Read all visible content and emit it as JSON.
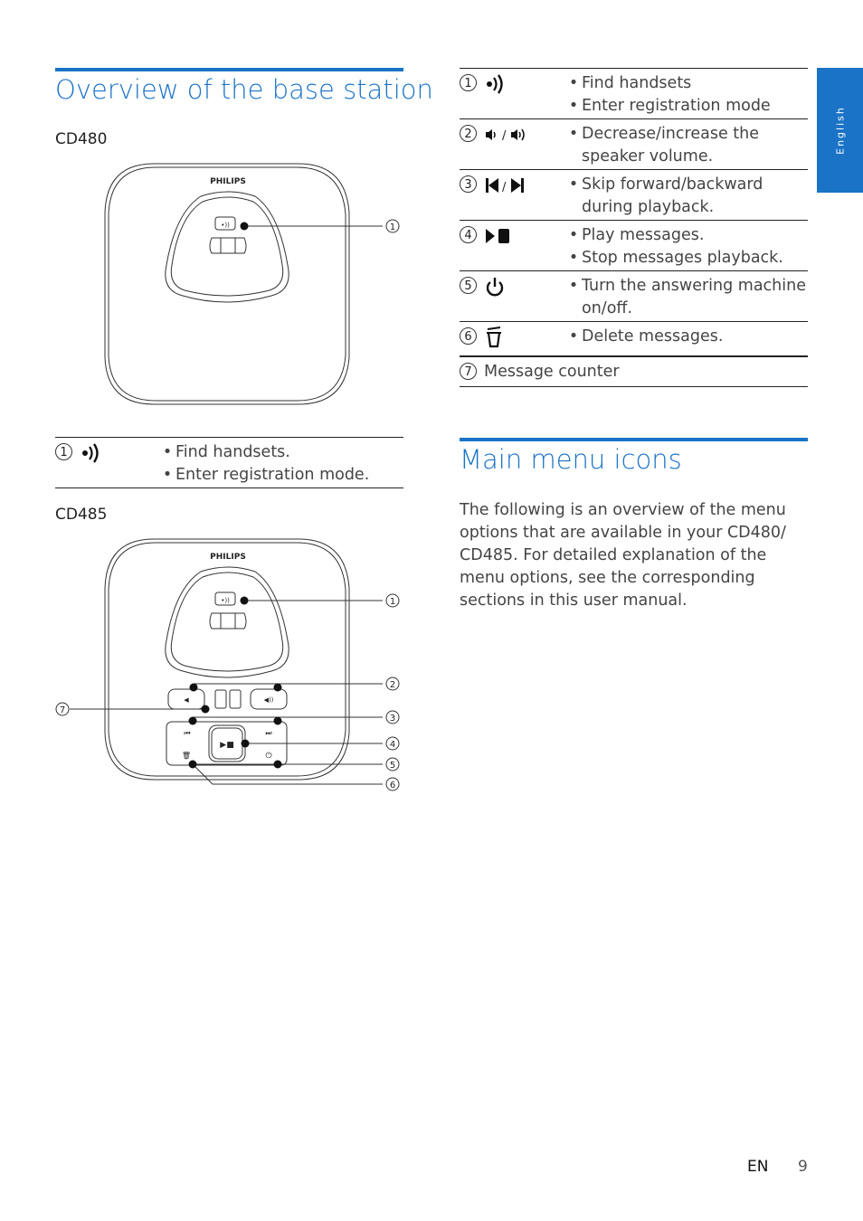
{
  "side_tab": {
    "label": "English"
  },
  "left": {
    "title": "Overview of the base station",
    "cd480": {
      "label": "CD480",
      "brand": "PHILIPS",
      "callouts": [
        "1"
      ],
      "table": [
        {
          "num": "1",
          "icon": "find-handset-icon",
          "bullets": [
            "Find handsets.",
            "Enter registration mode."
          ]
        }
      ]
    },
    "cd485": {
      "label": "CD485",
      "brand": "PHILIPS",
      "callouts": [
        "1",
        "2",
        "3",
        "4",
        "5",
        "6",
        "7"
      ]
    }
  },
  "right": {
    "table": [
      {
        "num": "1",
        "icon": "find-handset-icon",
        "bullets": [
          "Find handsets",
          "Enter registration mode"
        ]
      },
      {
        "num": "2",
        "icon": "volume-down-up-icon",
        "separator": "/",
        "bullets": [
          "Decrease/increase the speaker volume."
        ]
      },
      {
        "num": "3",
        "icon": "skip-back-forward-icon",
        "separator": "/",
        "bullets": [
          "Skip forward/backward during playback."
        ]
      },
      {
        "num": "4",
        "icon": "play-stop-icon",
        "bullets": [
          "Play messages.",
          "Stop messages playback."
        ]
      },
      {
        "num": "5",
        "icon": "power-icon",
        "bullets": [
          "Turn the answering machine on/off."
        ]
      },
      {
        "num": "6",
        "icon": "delete-icon",
        "bullets": [
          "Delete messages."
        ]
      },
      {
        "num": "7",
        "text": "Message counter"
      }
    ],
    "menu_title": "Main menu icons",
    "menu_paragraph": "The following is an overview of the menu options that are available in your CD480/ CD485. For detailed explanation of the menu options, see the corresponding sections in this user manual."
  },
  "footer": {
    "lang": "EN",
    "page": "9"
  },
  "colors": {
    "accent": "#1a73c6",
    "text": "#444444"
  }
}
